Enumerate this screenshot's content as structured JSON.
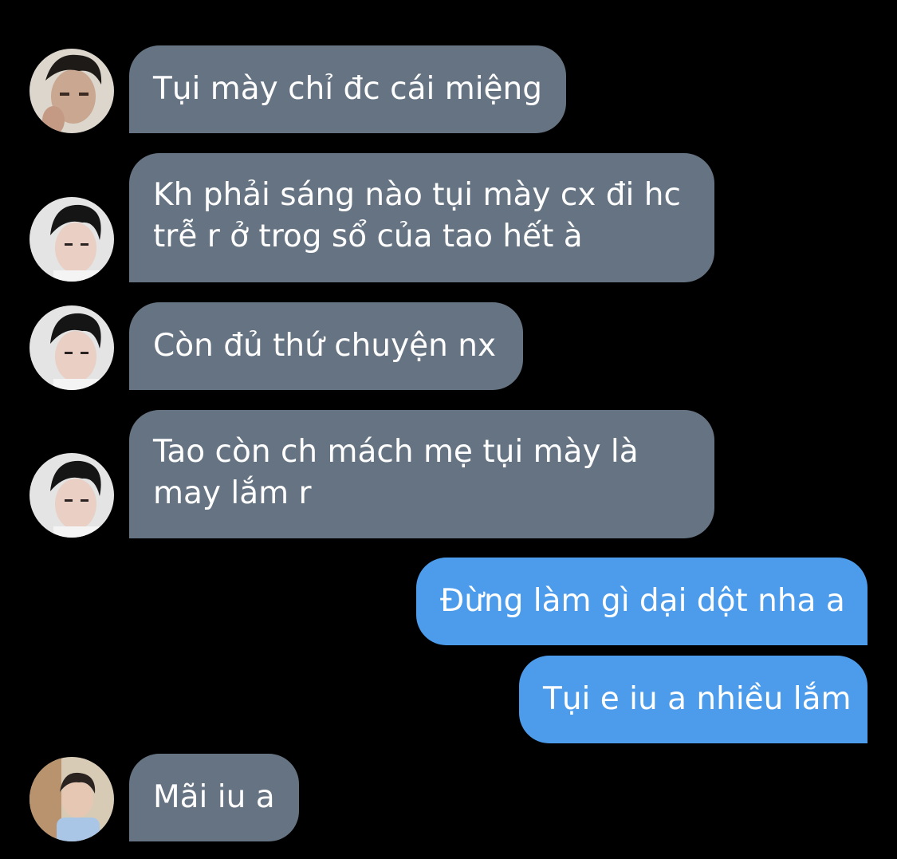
{
  "conversation": {
    "messages": [
      {
        "sender": "them",
        "avatar": "avatar-photo-1",
        "lines": [
          "Tụi mày chỉ đc cái miệng"
        ]
      },
      {
        "sender": "them",
        "avatar": "avatar-photo-2",
        "lines": [
          "Kh phải sáng nào tụi mày cx đi hc",
          "trễ r ở trog sổ của tao hết à"
        ]
      },
      {
        "sender": "them",
        "avatar": "avatar-photo-2",
        "lines": [
          "Còn đủ thứ chuyện nx"
        ]
      },
      {
        "sender": "them",
        "avatar": "avatar-photo-2",
        "lines": [
          "Tao còn ch mách mẹ tụi mày là",
          "may lắm r"
        ]
      },
      {
        "sender": "me",
        "lines": [
          "Đừng làm gì dại dột nha a"
        ]
      },
      {
        "sender": "me",
        "lines": [
          "Tụi e iu a nhiều lắm"
        ]
      },
      {
        "sender": "them",
        "avatar": "avatar-photo-3",
        "lines": [
          "Mãi iu a"
        ]
      }
    ]
  },
  "colors": {
    "background": "#000000",
    "incoming_bubble": "#657382",
    "outgoing_bubble": "#4c9ceb",
    "text": "#ffffff"
  }
}
